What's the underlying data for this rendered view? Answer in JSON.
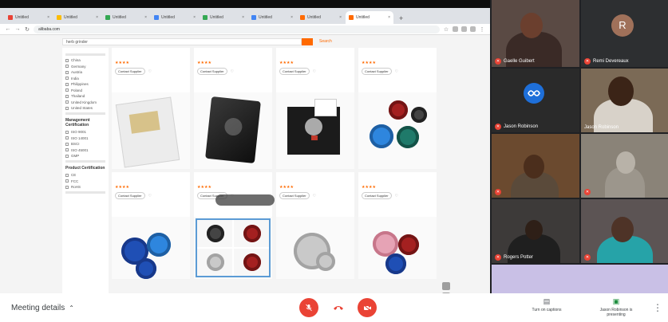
{
  "browser": {
    "tabs": [
      {
        "title": "Untitled",
        "color": "#e94235"
      },
      {
        "title": "Untitled",
        "color": "#fbbc04"
      },
      {
        "title": "Untitled",
        "color": "#34a853"
      },
      {
        "title": "Untitled",
        "color": "#4285f4"
      },
      {
        "title": "Untitled",
        "color": "#34a853"
      },
      {
        "title": "Untitled",
        "color": "#4285f4"
      },
      {
        "title": "Untitled",
        "color": "#ff6a00"
      },
      {
        "title": "Untitled",
        "color": "#ff6a00"
      }
    ],
    "active_tab_index": 7,
    "url": "alibaba.com"
  },
  "site": {
    "search_placeholder": "herb grinder",
    "search_extra": "Search"
  },
  "filters": {
    "groups": [
      {
        "head": "",
        "pill": "",
        "items": [
          "China",
          "Germany",
          "Austria",
          "India",
          "Philippines",
          "Poland",
          "Thailand",
          "United Kingdom",
          "United States"
        ]
      },
      {
        "head": "Management Certification",
        "pill": "",
        "items": [
          "ISO 9001",
          "ISO 14001",
          "BSCI",
          "ISO 45001",
          "GMP"
        ]
      },
      {
        "head": "Product Certification",
        "pill": "",
        "items": [
          "CE",
          "FCC",
          "RoHS"
        ]
      }
    ]
  },
  "products": {
    "columns": [
      [
        {
          "name": "",
          "price": "",
          "moq": "",
          "stars": "★★★★",
          "meta": "",
          "button": "Contact Supplier",
          "img": "cards"
        },
        {
          "name": "",
          "price": "",
          "moq": "",
          "stars": "★★★★",
          "meta": "",
          "button": "Contact Supplier",
          "img": "discs-blue"
        }
      ],
      [
        {
          "name": "",
          "price": "",
          "moq": "",
          "stars": "★★★★",
          "meta": "",
          "button": "Contact Supplier",
          "img": "metal-card"
        },
        {
          "name": "",
          "price": "",
          "moq": "",
          "stars": "★★★★",
          "meta": "",
          "button": "Contact Supplier",
          "img": "grid4"
        }
      ],
      [
        {
          "name": "",
          "price": "",
          "moq": "",
          "stars": "★★★★",
          "meta": "",
          "button": "Contact Supplier",
          "img": "blackbox"
        },
        {
          "name": "",
          "price": "",
          "moq": "",
          "stars": "★★★★",
          "meta": "",
          "button": "Contact Supplier",
          "img": "silver"
        }
      ],
      [
        {
          "name": "",
          "price": "",
          "moq": "",
          "stars": "★★★★",
          "meta": "",
          "button": "Contact Supplier",
          "img": "discs-colors"
        },
        {
          "name": "",
          "price": "",
          "moq": "",
          "stars": "★★★★",
          "meta": "",
          "button": "Contact Supplier",
          "img": "discs-pink"
        }
      ]
    ]
  },
  "participants": [
    {
      "name": "Gaelle Guibert",
      "muted": true,
      "kind": "video"
    },
    {
      "name": "Remi Devereaux",
      "muted": true,
      "kind": "avatar",
      "initial": "R"
    },
    {
      "name": "Jason Robinson",
      "muted": true,
      "kind": "logo"
    },
    {
      "name": "Jason Robinson",
      "muted": false,
      "kind": "video"
    },
    {
      "name": "",
      "muted": true,
      "kind": "video"
    },
    {
      "name": "",
      "muted": true,
      "kind": "video"
    },
    {
      "name": "Rogers Potter",
      "muted": true,
      "kind": "video"
    },
    {
      "name": "",
      "muted": true,
      "kind": "video"
    },
    {
      "name": "",
      "muted": false,
      "kind": "video"
    }
  ],
  "bottom": {
    "meeting_details": "Meeting details",
    "chevron": "⌃",
    "captions_label": "Turn on captions",
    "presenting_label": "Jason Robinson is presenting",
    "more": "⋮"
  },
  "colors": {
    "accent_red": "#ea4335",
    "alibaba_orange": "#ff6a00",
    "presenting_green": "#1e8e3e"
  }
}
